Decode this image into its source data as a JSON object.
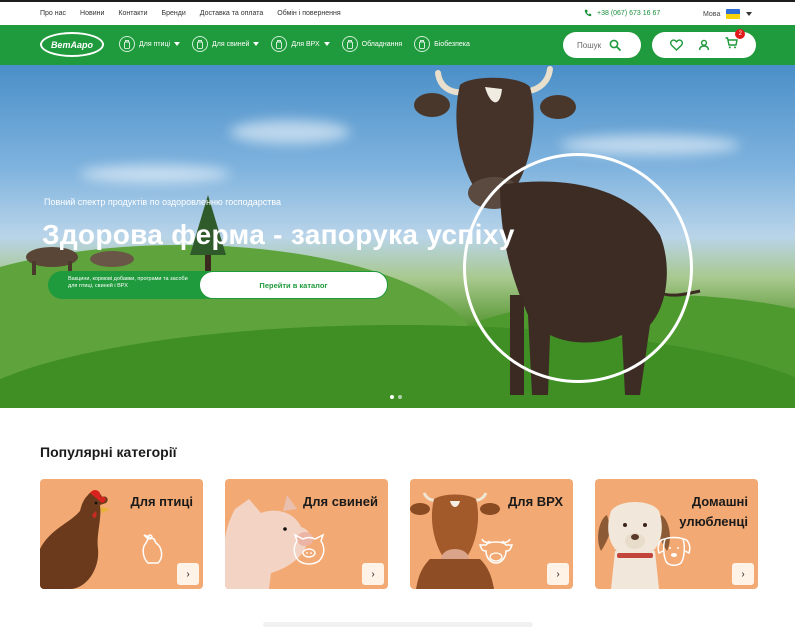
{
  "topnav": [
    "Про нас",
    "Новини",
    "Контакти",
    "Бренди",
    "Доставка та оплата",
    "Обмін і повернення"
  ],
  "phone": "+38 (067) 673 16 67",
  "lang_label": "Мова",
  "logo_text": "ВетАаро",
  "mainnav": [
    {
      "label": "Для птиці",
      "has_caret": true
    },
    {
      "label": "Для свиней",
      "has_caret": true
    },
    {
      "label": "Для ВРХ",
      "has_caret": true
    },
    {
      "label": "Обладнання",
      "has_caret": false
    },
    {
      "label": "Біобезпека",
      "has_caret": false
    }
  ],
  "search": {
    "placeholder": "Пошук"
  },
  "cart_count": "2",
  "hero": {
    "subtitle": "Повний спектр продуктів по оздоровленню господарства",
    "title": "Здорова ферма - запорука успіху",
    "note": "Вакцини, кормові добавки, програми та засоби для птиці, свиней і ВРХ",
    "cta_label": "Перейти в каталог",
    "slides": 2,
    "active_slide": 1
  },
  "categories": {
    "title": "Популярні категорії",
    "items": [
      {
        "label": "Для птиці",
        "icon": "chicken-icon"
      },
      {
        "label": "Для свиней",
        "icon": "pig-icon"
      },
      {
        "label": "Для ВРХ",
        "icon": "cow-icon"
      },
      {
        "label": "Домашні\nулюбленці",
        "icon": "dog-icon"
      }
    ],
    "arrow": "›"
  },
  "colors": {
    "brand_green": "#1f9a3c",
    "card_orange": "#f3a973",
    "badge_red": "#e21a1a"
  }
}
